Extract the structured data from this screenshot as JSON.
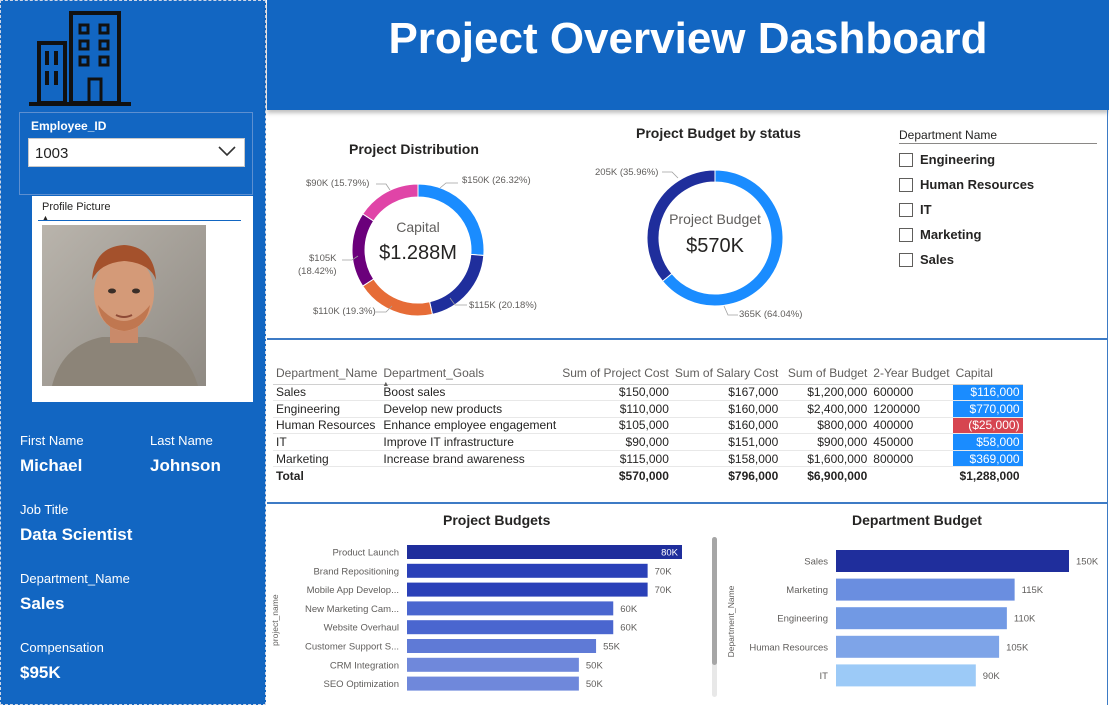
{
  "header": {
    "title": "Project Overview Dashboard"
  },
  "sidebar": {
    "employee_filter": {
      "label": "Employee_ID",
      "selected": "1003"
    },
    "profile": {
      "title": "Profile Picture"
    },
    "first_name": {
      "label": "First Name",
      "value": "Michael"
    },
    "last_name": {
      "label": "Last Name",
      "value": "Johnson"
    },
    "job_title": {
      "label": "Job Title",
      "value": "Data Scientist"
    },
    "department": {
      "label": "Department_Name",
      "value": "Sales"
    },
    "compensation": {
      "label": "Compensation",
      "value": "$95K"
    }
  },
  "department_filter": {
    "title": "Department Name",
    "options": [
      "Engineering",
      "Human Resources",
      "IT",
      "Marketing",
      "Sales"
    ]
  },
  "table": {
    "columns": [
      "Department_Name",
      "Department_Goals",
      "Sum of Project Cost",
      "Sum of Salary Cost",
      "Sum of Budget",
      "2-Year Budget",
      "Capital"
    ],
    "rows": [
      [
        "Sales",
        "Boost sales",
        "$150,000",
        "$167,000",
        "$1,200,000",
        "600000",
        "$116,000"
      ],
      [
        "Engineering",
        "Develop new products",
        "$110,000",
        "$160,000",
        "$2,400,000",
        "1200000",
        "$770,000"
      ],
      [
        "Human Resources",
        "Enhance employee engagement",
        "$105,000",
        "$160,000",
        "$800,000",
        "400000",
        "($25,000)"
      ],
      [
        "IT",
        "Improve IT infrastructure",
        "$90,000",
        "$151,000",
        "$900,000",
        "450000",
        "$58,000"
      ],
      [
        "Marketing",
        "Increase brand awareness",
        "$115,000",
        "$158,000",
        "$1,600,000",
        "800000",
        "$369,000"
      ]
    ],
    "total": [
      "Total",
      "",
      "$570,000",
      "$796,000",
      "$6,900,000",
      "",
      "$1,288,000"
    ]
  },
  "colors": {
    "sidebar": "#1266c2",
    "capital_positive": "#1a8cff",
    "capital_negative": "#d64550"
  },
  "chart_data": [
    {
      "type": "pie",
      "title": "Project Distribution",
      "center_label": "Capital",
      "center_value": "$1.288M",
      "slices": [
        {
          "value": 150,
          "label": "$150K (26.32%)",
          "color": "#1a8cff"
        },
        {
          "value": 115,
          "label": "$115K (20.18%)",
          "color": "#1f2e9c"
        },
        {
          "value": 110,
          "label": "$110K (19.3%)",
          "color": "#e66c37"
        },
        {
          "value": 105,
          "label_lines": [
            "$105K",
            "(18.42%)"
          ],
          "color": "#6b007b"
        },
        {
          "value": 90,
          "label": "$90K (15.79%)",
          "color": "#e044a7"
        }
      ]
    },
    {
      "type": "pie",
      "title": "Project Budget by status",
      "center_label": "Project Budget",
      "center_value": "$570K",
      "slices": [
        {
          "value": 365,
          "label": "365K (64.04%)",
          "color": "#1a8cff"
        },
        {
          "value": 205,
          "label": "205K (35.96%)",
          "color": "#1f2e9c"
        }
      ]
    },
    {
      "type": "bar",
      "orientation": "horizontal",
      "title": "Project Budgets",
      "ylabel": "project_name",
      "categories": [
        "Product Launch",
        "Brand Repositioning",
        "Mobile App Develop...",
        "New Marketing Cam...",
        "Website Overhaul",
        "Customer Support S...",
        "CRM Integration",
        "SEO Optimization"
      ],
      "values": [
        80,
        70,
        70,
        60,
        60,
        55,
        50,
        50
      ],
      "labels": [
        "80K",
        "70K",
        "70K",
        "60K",
        "60K",
        "55K",
        "50K",
        "50K"
      ],
      "colors": [
        "#1f2e9c",
        "#2a40b8",
        "#2a40b8",
        "#4a66cf",
        "#4a66cf",
        "#5f7ad6",
        "#6f88db",
        "#6f88db"
      ]
    },
    {
      "type": "bar",
      "orientation": "horizontal",
      "title": "Department Budget",
      "ylabel": "Department_Name",
      "categories": [
        "Sales",
        "Marketing",
        "Engineering",
        "Human Resources",
        "IT"
      ],
      "values": [
        150,
        115,
        110,
        105,
        90
      ],
      "labels": [
        "150K",
        "115K",
        "110K",
        "105K",
        "90K"
      ],
      "colors": [
        "#1f2e9c",
        "#6a8ee0",
        "#7199e4",
        "#7ea4e8",
        "#9ccaf7"
      ]
    }
  ]
}
